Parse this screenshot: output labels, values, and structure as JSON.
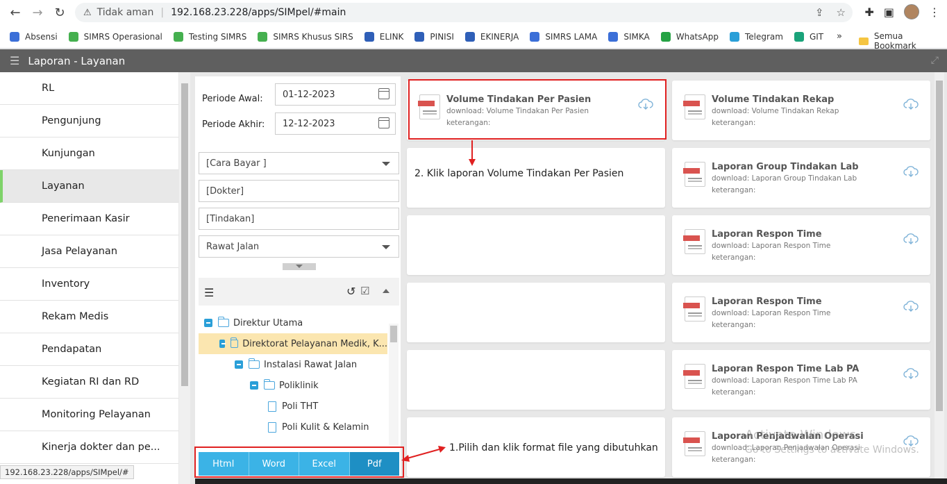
{
  "browser": {
    "security_label": "Tidak aman",
    "url": "192.168.23.228/apps/SIMpel/#main",
    "status_url": "192.168.23.228/apps/SIMpel/#"
  },
  "bookmarks": [
    {
      "label": "Absensi",
      "color": "#3b6fd8"
    },
    {
      "label": "SIMRS Operasional",
      "color": "#45b04f"
    },
    {
      "label": "Testing SIMRS",
      "color": "#45b04f"
    },
    {
      "label": "SIMRS Khusus SIRS",
      "color": "#45b04f"
    },
    {
      "label": "ELINK",
      "color": "#2f5fb8"
    },
    {
      "label": "PINISI",
      "color": "#2f5fb8"
    },
    {
      "label": "EKINERJA",
      "color": "#2f5fb8"
    },
    {
      "label": "SIMRS LAMA",
      "color": "#3b6fd8"
    },
    {
      "label": "SIMKA",
      "color": "#3b6fd8"
    },
    {
      "label": "WhatsApp",
      "color": "#25a244"
    },
    {
      "label": "Telegram",
      "color": "#2a9fd8"
    },
    {
      "label": "GIT",
      "color": "#1aa37a"
    }
  ],
  "bookmarks_more": "»",
  "bookmarks_all": "Semua Bookmark",
  "app": {
    "title": "Laporan - Layanan"
  },
  "sidebar": {
    "items": [
      {
        "label": "RL"
      },
      {
        "label": "Pengunjung"
      },
      {
        "label": "Kunjungan"
      },
      {
        "label": "Layanan"
      },
      {
        "label": "Penerimaan Kasir"
      },
      {
        "label": "Jasa Pelayanan"
      },
      {
        "label": "Inventory"
      },
      {
        "label": "Rekam Medis"
      },
      {
        "label": "Pendapatan"
      },
      {
        "label": "Kegiatan RI dan RD"
      },
      {
        "label": "Monitoring Pelayanan"
      },
      {
        "label": "Kinerja dokter dan pe..."
      }
    ],
    "active_index": 3
  },
  "filters": {
    "periode_awal_label": "Periode Awal:",
    "periode_awal_value": "01-12-2023",
    "periode_akhir_label": "Periode Akhir:",
    "periode_akhir_value": "12-12-2023",
    "cara_bayar": "[Cara Bayar ]",
    "dokter": "[Dokter]",
    "tindakan": "[Tindakan]",
    "jenis": "Rawat Jalan"
  },
  "tree": [
    {
      "label": "Direktur Utama",
      "type": "folder"
    },
    {
      "label": "Direktorat Pelayanan Medik, K...",
      "type": "folder"
    },
    {
      "label": "Instalasi Rawat Jalan",
      "type": "folder"
    },
    {
      "label": "Poliklinik",
      "type": "folder"
    },
    {
      "label": "Poli THT",
      "type": "file"
    },
    {
      "label": "Poli Kulit & Kelamin",
      "type": "file"
    }
  ],
  "formats": [
    "Html",
    "Word",
    "Excel",
    "Pdf"
  ],
  "reports": [
    {
      "title": "Volume Tindakan Per Pasien",
      "download": "download: Volume Tindakan Per Pasien",
      "keterangan": "keterangan:"
    },
    {
      "title": "Volume Tindakan Rekap",
      "download": "download: Volume Tindakan Rekap",
      "keterangan": "keterangan:"
    },
    {
      "title": "Laporan Group Tindakan Lab",
      "download": "download: Laporan Group Tindakan Lab",
      "keterangan": "keterangan:"
    },
    {
      "title": "Laporan Respon Time",
      "download": "download: Laporan Respon Time",
      "keterangan": "keterangan:"
    },
    {
      "title": "Laporan Respon Time",
      "download": "download: Laporan Respon Time",
      "keterangan": "keterangan:"
    },
    {
      "title": "Laporan Respon Time Lab PA",
      "download": "download: Laporan Respon Time Lab PA",
      "keterangan": "keterangan:"
    },
    {
      "title": "Laporan Penjadwalan Operasi",
      "download": "download: Laporan Penjadwalan Operasi",
      "keterangan": "keterangan:"
    }
  ],
  "annotations": {
    "step2": "2. Klik laporan Volume Tindakan Per Pasien",
    "step1": "1.Pilih dan klik format file yang dibutuhkan"
  },
  "watermark": {
    "line1": "Activate Windows",
    "line2": "Go to Settings to activate Windows."
  },
  "colors": {
    "accent": "#3bb3e6",
    "active_marker": "#7fd36a",
    "annotation_red": "#e02020"
  }
}
